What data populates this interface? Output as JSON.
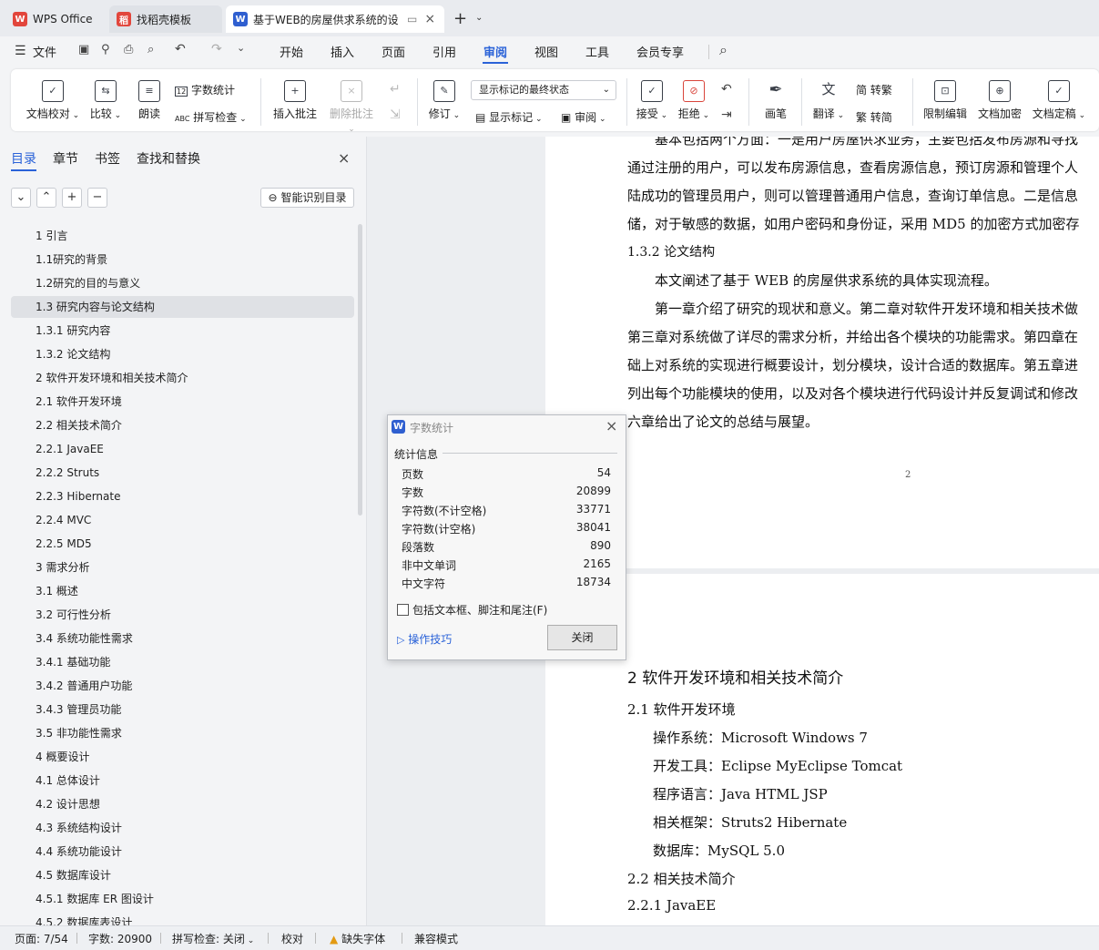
{
  "titlebar": {
    "tabs": [
      {
        "label": "WPS Office"
      },
      {
        "label": "找稻壳模板"
      },
      {
        "label": "基于WEB的房屋供求系统的设"
      }
    ],
    "new_tab": "+"
  },
  "menubar": {
    "file": "文件",
    "items": [
      "开始",
      "插入",
      "页面",
      "引用",
      "审阅",
      "视图",
      "工具",
      "会员专享"
    ],
    "active": "审阅"
  },
  "ribbon": {
    "doc_check": "文档校对",
    "compare": "比较",
    "read_aloud": "朗读",
    "word_count": "字数统计",
    "spell_check": "拼写检查",
    "insert_comment": "插入批注",
    "delete_comment": "删除批注",
    "revise": "修订",
    "markup_state": "显示标记的最终状态",
    "show_markup": "显示标记",
    "review": "审阅",
    "accept": "接受",
    "reject": "拒绝",
    "pen": "画笔",
    "translate": "翻译",
    "to_traditional": "转繁",
    "to_simplified": "转简",
    "restrict_edit": "限制编辑",
    "doc_encrypt": "文档加密",
    "doc_finalize": "文档定稿"
  },
  "nav": {
    "tabs": [
      "目录",
      "章节",
      "书签",
      "查找和替换"
    ],
    "smart_toc": "智能识别目录",
    "toc": [
      "1 引言",
      "1.1研究的背景",
      "1.2研究的目的与意义",
      "1.3 研究内容与论文结构",
      "1.3.1 研究内容",
      "1.3.2 论文结构",
      "2 软件开发环境和相关技术简介",
      "2.1 软件开发环境",
      "2.2 相关技术简介",
      "2.2.1 JavaEE",
      "2.2.2 Struts",
      "2.2.3 Hibernate",
      "2.2.4 MVC",
      "2.2.5 MD5",
      "3 需求分析",
      "3.1 概述",
      "3.2 可行性分析",
      "3.4 系统功能性需求",
      "3.4.1 基础功能",
      "3.4.2 普通用户功能",
      "3.4.3 管理员功能",
      "3.5 非功能性需求",
      "4 概要设计",
      "4.1 总体设计",
      "4.2 设计思想",
      "4.3 系统结构设计",
      "4.4 系统功能设计",
      "4.5 数据库设计",
      "4.5.1 数据库 ER 图设计",
      "4.5.2 数据库表设计"
    ],
    "selected_index": 3
  },
  "document": {
    "page1_lines": [
      "基本包括两个方面：一是用户房屋供求业务，主要包括发布房源和寻找",
      "通过注册的用户，可以发布房源信息，查看房源信息，预订房源和管理个人",
      "陆成功的管理员用户，则可以管理普通用户信息，查询订单信息。二是信息",
      "储，对于敏感的数据，如用户密码和身份证，采用 MD5 的加密方式加密存",
      "1.3.2  论文结构",
      "本文阐述了基于 WEB 的房屋供求系统的具体实现流程。",
      "第一章介绍了研究的现状和意义。第二章对软件开发环境和相关技术做",
      "第三章对系统做了详尽的需求分析，并给出各个模块的功能需求。第四章在",
      "础上对系统的实现进行概要设计，划分模块，设计合适的数据库。第五章进",
      "列出每个功能模块的使用，以及对各个模块进行代码设计并反复调试和修改",
      "六章给出了论文的总结与展望。"
    ],
    "page_number": "2",
    "page2_lines": [
      "2  软件开发环境和相关技术简介",
      "2.1  软件开发环境",
      "操作系统：Microsoft Windows 7",
      "开发工具：Eclipse    MyEclipse    Tomcat",
      "程序语言：Java    HTML    JSP",
      "相关框架：Struts2    Hibernate",
      "数据库：MySQL 5.0",
      "2.2  相关技术简介",
      "2.2.1 JavaEE"
    ]
  },
  "dialog": {
    "title": "字数统计",
    "section": "统计信息",
    "stats": [
      {
        "label": "页数",
        "value": "54"
      },
      {
        "label": "字数",
        "value": "20899"
      },
      {
        "label": "字符数(不计空格)",
        "value": "33771"
      },
      {
        "label": "字符数(计空格)",
        "value": "38041"
      },
      {
        "label": "段落数",
        "value": "890"
      },
      {
        "label": "非中文单词",
        "value": "2165"
      },
      {
        "label": "中文字符",
        "value": "18734"
      }
    ],
    "checkbox_label": "包括文本框、脚注和尾注(F)",
    "tips": "操作技巧",
    "close_button": "关闭"
  },
  "statusbar": {
    "page": "页面: 7/54",
    "words": "字数: 20900",
    "spell": "拼写检查: 关闭",
    "proof": "校对",
    "missing_font": "缺失字体",
    "compat": "兼容模式"
  },
  "colors": {
    "accent": "#2a62d8",
    "wps_red": "#e2463c",
    "word_blue": "#2f5fd0"
  }
}
